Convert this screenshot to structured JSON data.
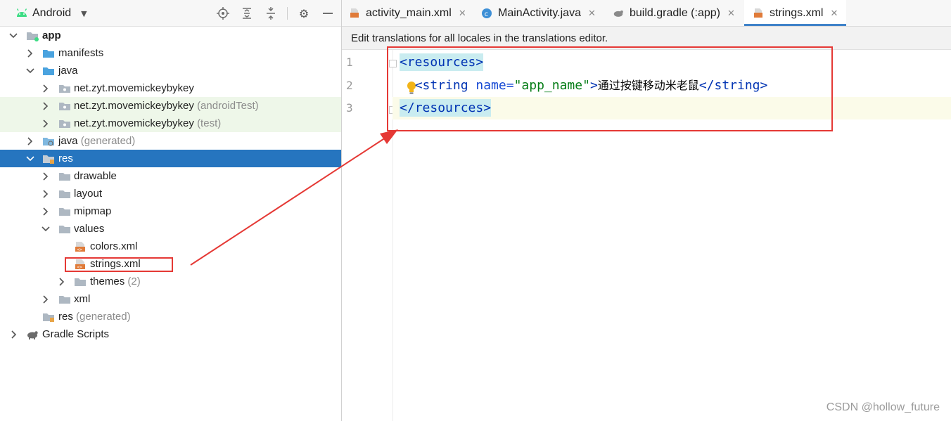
{
  "project_panel": {
    "view_name": "Android",
    "toolbar_icons": [
      "locate-icon",
      "expand-all-icon",
      "collapse-all-icon",
      "gear-icon",
      "minimize-icon"
    ],
    "tree": [
      {
        "label": "app",
        "suffix": ""
      },
      {
        "label": "manifests",
        "suffix": ""
      },
      {
        "label": "java",
        "suffix": ""
      },
      {
        "label": "net.zyt.movemickeybykey",
        "suffix": ""
      },
      {
        "label": "net.zyt.movemickeybykey",
        "suffix": "(androidTest)"
      },
      {
        "label": "net.zyt.movemickeybykey",
        "suffix": "(test)"
      },
      {
        "label": "java",
        "suffix": "(generated)"
      },
      {
        "label": "res",
        "suffix": ""
      },
      {
        "label": "drawable",
        "suffix": ""
      },
      {
        "label": "layout",
        "suffix": ""
      },
      {
        "label": "mipmap",
        "suffix": ""
      },
      {
        "label": "values",
        "suffix": ""
      },
      {
        "label": "colors.xml",
        "suffix": ""
      },
      {
        "label": "strings.xml",
        "suffix": ""
      },
      {
        "label": "themes",
        "suffix": "(2)"
      },
      {
        "label": "xml",
        "suffix": ""
      },
      {
        "label": "res",
        "suffix": "(generated)"
      },
      {
        "label": "Gradle Scripts",
        "suffix": ""
      }
    ]
  },
  "editor": {
    "tabs": [
      {
        "label": "activity_main.xml",
        "icon": "xml-file-icon"
      },
      {
        "label": "MainActivity.java",
        "icon": "java-class-icon"
      },
      {
        "label": "build.gradle (:app)",
        "icon": "gradle-icon"
      },
      {
        "label": "strings.xml",
        "icon": "xml-file-icon"
      }
    ],
    "active_tab": "strings.xml",
    "notice": "Edit translations for all locales in the translations editor.",
    "line_numbers": [
      "1",
      "2",
      "3"
    ],
    "code": {
      "l1_open": "<",
      "l1_tag": "resources",
      "l1_close": ">",
      "l2_indent": "  ",
      "l2_open": "<string",
      "l2_attr": " name=",
      "l2_val": "\"app_name\"",
      "l2_gt": ">",
      "l2_text": "通过按键移动米老鼠",
      "l2_end": "</string>",
      "l3_open": "</",
      "l3_tag": "resources",
      "l3_close": ">"
    }
  },
  "watermark": "CSDN @hollow_future",
  "colors": {
    "selection": "#2675bf",
    "annotation": "#e53935",
    "tab_underline": "#4083c9"
  }
}
